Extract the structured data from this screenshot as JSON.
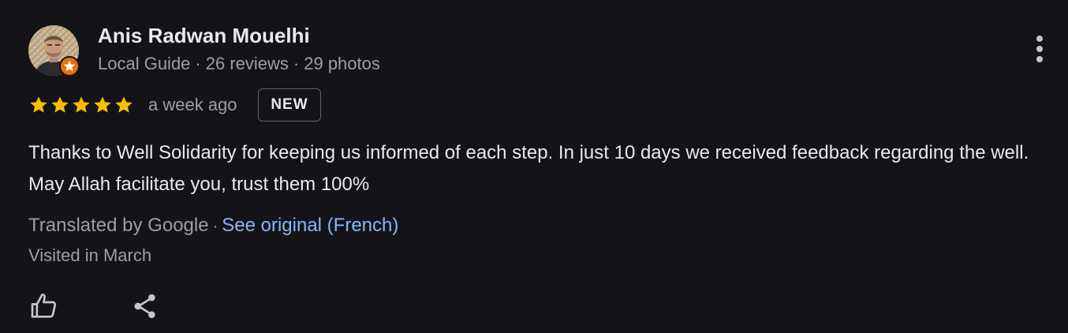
{
  "author": {
    "name": "Anis Radwan Mouelhi",
    "meta": {
      "role": "Local Guide",
      "separator": "·",
      "reviews": "26 reviews",
      "photos": "29 photos"
    },
    "avatar_icon": "user-avatar",
    "badge_icon": "local-guide-star-icon",
    "badge_color": "#e8710a"
  },
  "review": {
    "rating": 5,
    "max_rating": 5,
    "star_color": "#fbbc04",
    "date": "a week ago",
    "new_badge": "NEW",
    "text": "Thanks to Well Solidarity for keeping us informed of each step. In just 10 days we received feedback regarding the well. May Allah facilitate you, trust them 100%",
    "translated_by": "Translated by Google",
    "separator": "·",
    "see_original": "See original (French)",
    "visited": "Visited in March"
  },
  "actions": {
    "more_icon": "more-vert-icon",
    "like_icon": "thumb-up-icon",
    "share_icon": "share-icon"
  },
  "colors": {
    "background": "#131318",
    "primary_text": "#e8eaed",
    "secondary_text": "#9aa0a6",
    "link": "#8ab4f8"
  }
}
